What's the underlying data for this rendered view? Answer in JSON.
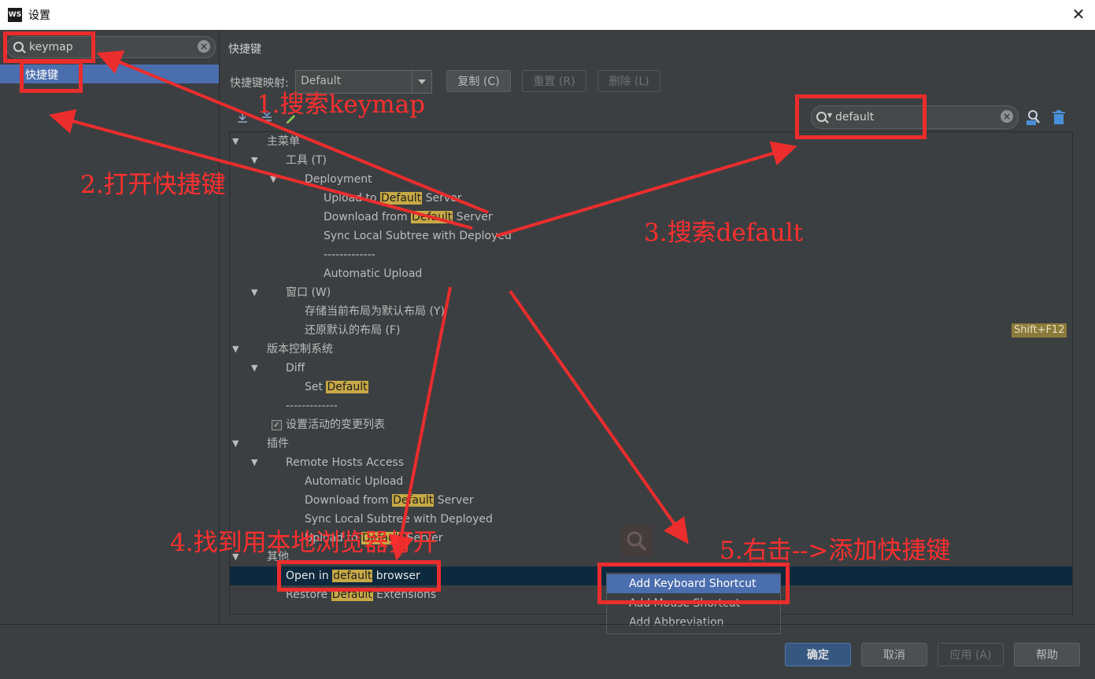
{
  "window": {
    "title": "设置",
    "app_logo": "WS",
    "close_glyph": "✕"
  },
  "sidebar": {
    "search": {
      "value": "keymap",
      "placeholder": ""
    },
    "items": [
      {
        "label": "快捷键"
      }
    ]
  },
  "main": {
    "page_title": "快捷键",
    "keymap_label": "快捷键映射:",
    "keymap_value": "Default",
    "buttons": {
      "copy": "复制 (C)",
      "reset": "重置 (R)",
      "delete": "删除 (L)"
    },
    "search": {
      "value": "default",
      "placeholder": ""
    },
    "tree": [
      {
        "label": "主菜单"
      },
      {
        "label": "工具 (T)"
      },
      {
        "label": "Deployment"
      },
      {
        "pre": "Upload to ",
        "hl": "Default",
        "post": " Server"
      },
      {
        "pre": "Download from ",
        "hl": "Default",
        "post": " Server"
      },
      {
        "label": "Sync Local Subtree with Deployed"
      },
      {
        "label": "-------------"
      },
      {
        "label": "Automatic Upload"
      },
      {
        "label": "窗口 (W)"
      },
      {
        "label": "存储当前布局为默认布局 (Y)"
      },
      {
        "label": "还原默认的布局 (F)",
        "shortcut": "Shift+F12"
      },
      {
        "label": "版本控制系统"
      },
      {
        "label": "Diff"
      },
      {
        "pre": "Set ",
        "hl": "Default",
        "post": ""
      },
      {
        "label": "-------------"
      },
      {
        "label": "设置活动的变更列表",
        "checkbox": "✓"
      },
      {
        "label": "插件"
      },
      {
        "label": "Remote Hosts Access"
      },
      {
        "label": "Automatic Upload"
      },
      {
        "pre": "Download from ",
        "hl": "Default",
        "post": " Server"
      },
      {
        "label": "Sync Local Subtree with Deployed"
      },
      {
        "pre": "Upload to ",
        "hl": "Default",
        "post": " Server"
      },
      {
        "label": "其他"
      },
      {
        "pre": "Open in ",
        "hl": "default",
        "post": " browser"
      },
      {
        "pre": "Restore ",
        "hl": "Default",
        "post": " Extensions"
      }
    ]
  },
  "context_menu": {
    "items": [
      "Add Keyboard Shortcut",
      "Add Mouse Shortcut",
      "Add Abbreviation"
    ],
    "selected_index": 0
  },
  "footer": {
    "ok": "确定",
    "cancel": "取消",
    "apply": "应用 (A)",
    "help": "帮助"
  },
  "annotations": {
    "step1": "1.搜索keymap",
    "step2": "2.打开快捷键",
    "step3": "3.搜索default",
    "step4": "4.找到用本地浏览器打开",
    "step5": "5.右击-->添加快捷键"
  },
  "colors": {
    "annotation_red": "#ec2d2d",
    "selection_blue": "#4b6eaf",
    "highlight": "#c7a946",
    "background": "#3c3f41"
  },
  "icons": [
    "search-icon",
    "clear-icon",
    "expand-all-icon",
    "collapse-all-icon",
    "edit-icon",
    "find-shortcut-icon",
    "trash-icon",
    "dropdown-arrow-icon",
    "tree-expand-icon",
    "checkbox-icon"
  ]
}
